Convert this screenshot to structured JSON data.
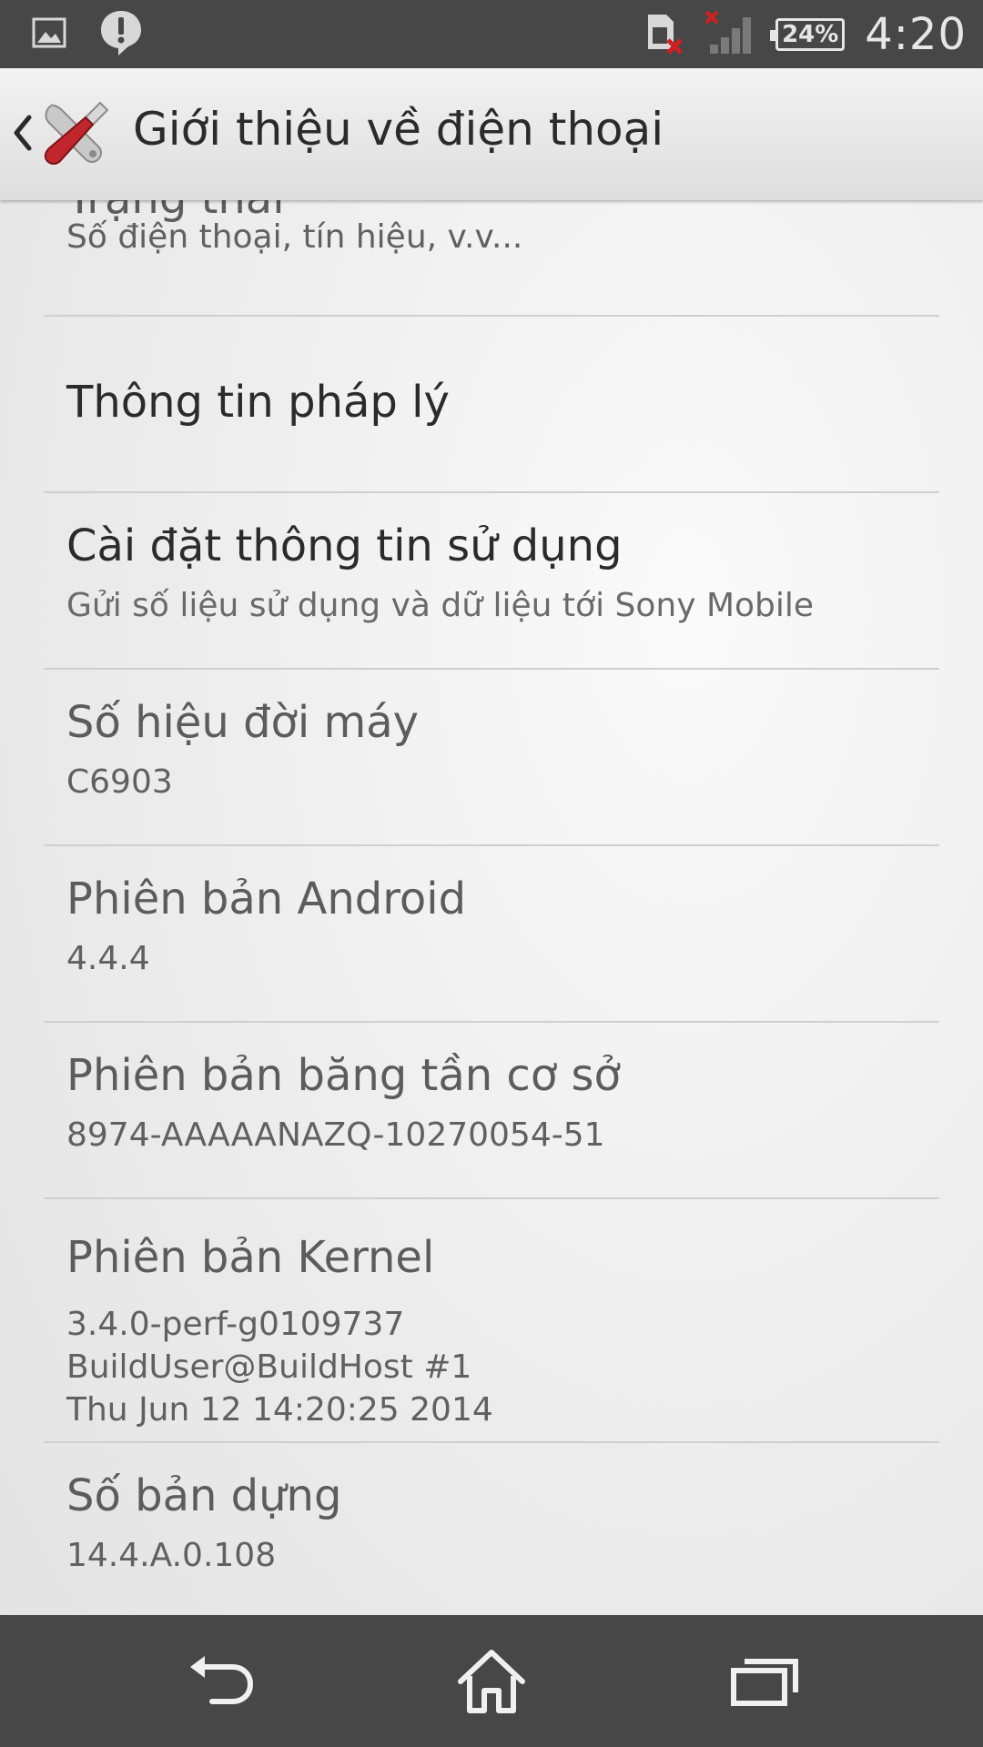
{
  "status_bar": {
    "time": "4:20",
    "battery": "24%",
    "icons": [
      "image-icon",
      "alert-icon",
      "sim-error-icon",
      "no-signal-icon",
      "battery-icon"
    ]
  },
  "action_bar": {
    "title": "Giới thiệu về điện thoại",
    "icons": [
      "back-chevron-icon",
      "settings-tools-icon"
    ]
  },
  "items": [
    {
      "title": "Trạng thái",
      "subtitle": "Số điện thoại, tín hiệu, v.v..."
    },
    {
      "title": "Thông tin pháp lý"
    },
    {
      "title": "Cài đặt thông tin sử dụng",
      "subtitle": "Gửi số liệu sử dụng và dữ liệu tới Sony Mobile"
    },
    {
      "title": "Số hiệu đời máy",
      "subtitle": "C6903"
    },
    {
      "title": "Phiên bản Android",
      "subtitle": "4.4.4"
    },
    {
      "title": "Phiên bản băng tần cơ sở",
      "subtitle": "8974-AAAAANAZQ-10270054-51"
    },
    {
      "title": "Phiên bản Kernel",
      "subtitle_lines": [
        "3.4.0-perf-g0109737",
        "BuildUser@BuildHost #1",
        "Thu Jun 12 14:20:25 2014"
      ]
    },
    {
      "title": "Số bản dựng",
      "subtitle": "14.4.A.0.108"
    }
  ],
  "nav_bar": {
    "icons": [
      "back-icon",
      "home-icon",
      "recents-icon"
    ]
  }
}
